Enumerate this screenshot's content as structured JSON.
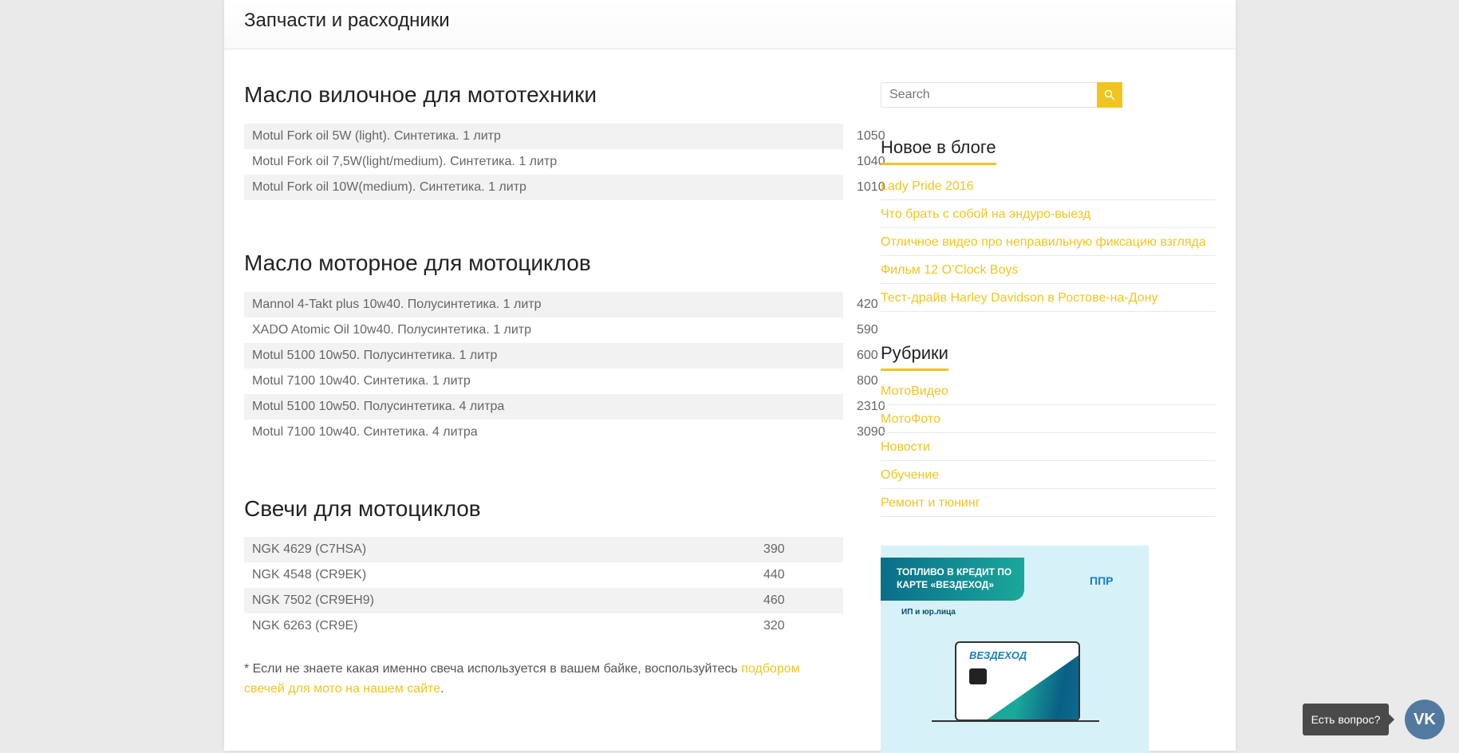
{
  "header": {
    "title": "Запчасти и расходники"
  },
  "sections": [
    {
      "title": "Масло вилочное для мототехники",
      "items": [
        {
          "name": "Motul Fork oil 5W (light). Синтетика. 1 литр",
          "price": "1050"
        },
        {
          "name": "Motul Fork oil 7,5W(light/medium). Синтетика. 1 литр",
          "price": "1040"
        },
        {
          "name": "Motul Fork oil 10W(medium). Синтетика. 1 литр",
          "price": "1010"
        }
      ]
    },
    {
      "title": "Масло моторное для мотоциклов",
      "items": [
        {
          "name": "Mannol 4-Takt plus 10w40. Полусинтетика. 1 литр",
          "price": "420"
        },
        {
          "name": "XADO Atomic Oil 10w40. Полусинтетика. 1 литр",
          "price": "590"
        },
        {
          "name": "Motul 5100 10w50. Полусинтетика. 1 литр",
          "price": "600"
        },
        {
          "name": "Motul 7100 10w40. Синтетика. 1 литр",
          "price": "800"
        },
        {
          "name": "Motul 5100 10w50. Полусинтетика. 4 литра",
          "price": "2310"
        },
        {
          "name": "Motul 7100 10w40. Синтетика. 4 литра",
          "price": "3090"
        }
      ]
    },
    {
      "title": "Свечи для мотоциклов",
      "items": [
        {
          "name": "NGK 4629 (C7HSA)",
          "price": "390"
        },
        {
          "name": "NGK 4548 (CR9EK)",
          "price": "440"
        },
        {
          "name": "NGK 7502 (CR9EH9)",
          "price": "460"
        },
        {
          "name": "NGK 6263 (CR9E)",
          "price": "320"
        }
      ]
    }
  ],
  "note": {
    "text": "* Если не знаете какая именно свеча используется в вашем байке, воспользуйтесь ",
    "link": "подбором свечей для мото на нашем сайте",
    "end": "."
  },
  "sidebar": {
    "search_placeholder": "Search",
    "blog_title": "Новое в блоге",
    "blog": [
      "Lady Pride 2016",
      "Что брать с собой на эндуро-выезд",
      "Отличное видео про неправильную фиксацию взгляда",
      "Фильм 12 O’Clock Boys",
      "Тест-драйв Harley Davidson в Ростове-на-Дону"
    ],
    "rubrics_title": "Рубрики",
    "rubrics": [
      "МотоВидео",
      "МотоФото",
      "Новости",
      "Обучение",
      "Ремонт и тюнинг"
    ],
    "ad": {
      "headline": "ТОПЛИВО В КРЕДИТ ПО КАРТЕ «ВЕЗДЕХОД»",
      "sub": "ИП и юр.лица",
      "logo": "ППР",
      "card": "ВЕЗДЕХОД"
    }
  },
  "chat": {
    "tooltip": "Есть вопрос?",
    "vk": "VK"
  },
  "colors": {
    "accent": "#f0c520",
    "vk": "#527aa0"
  }
}
